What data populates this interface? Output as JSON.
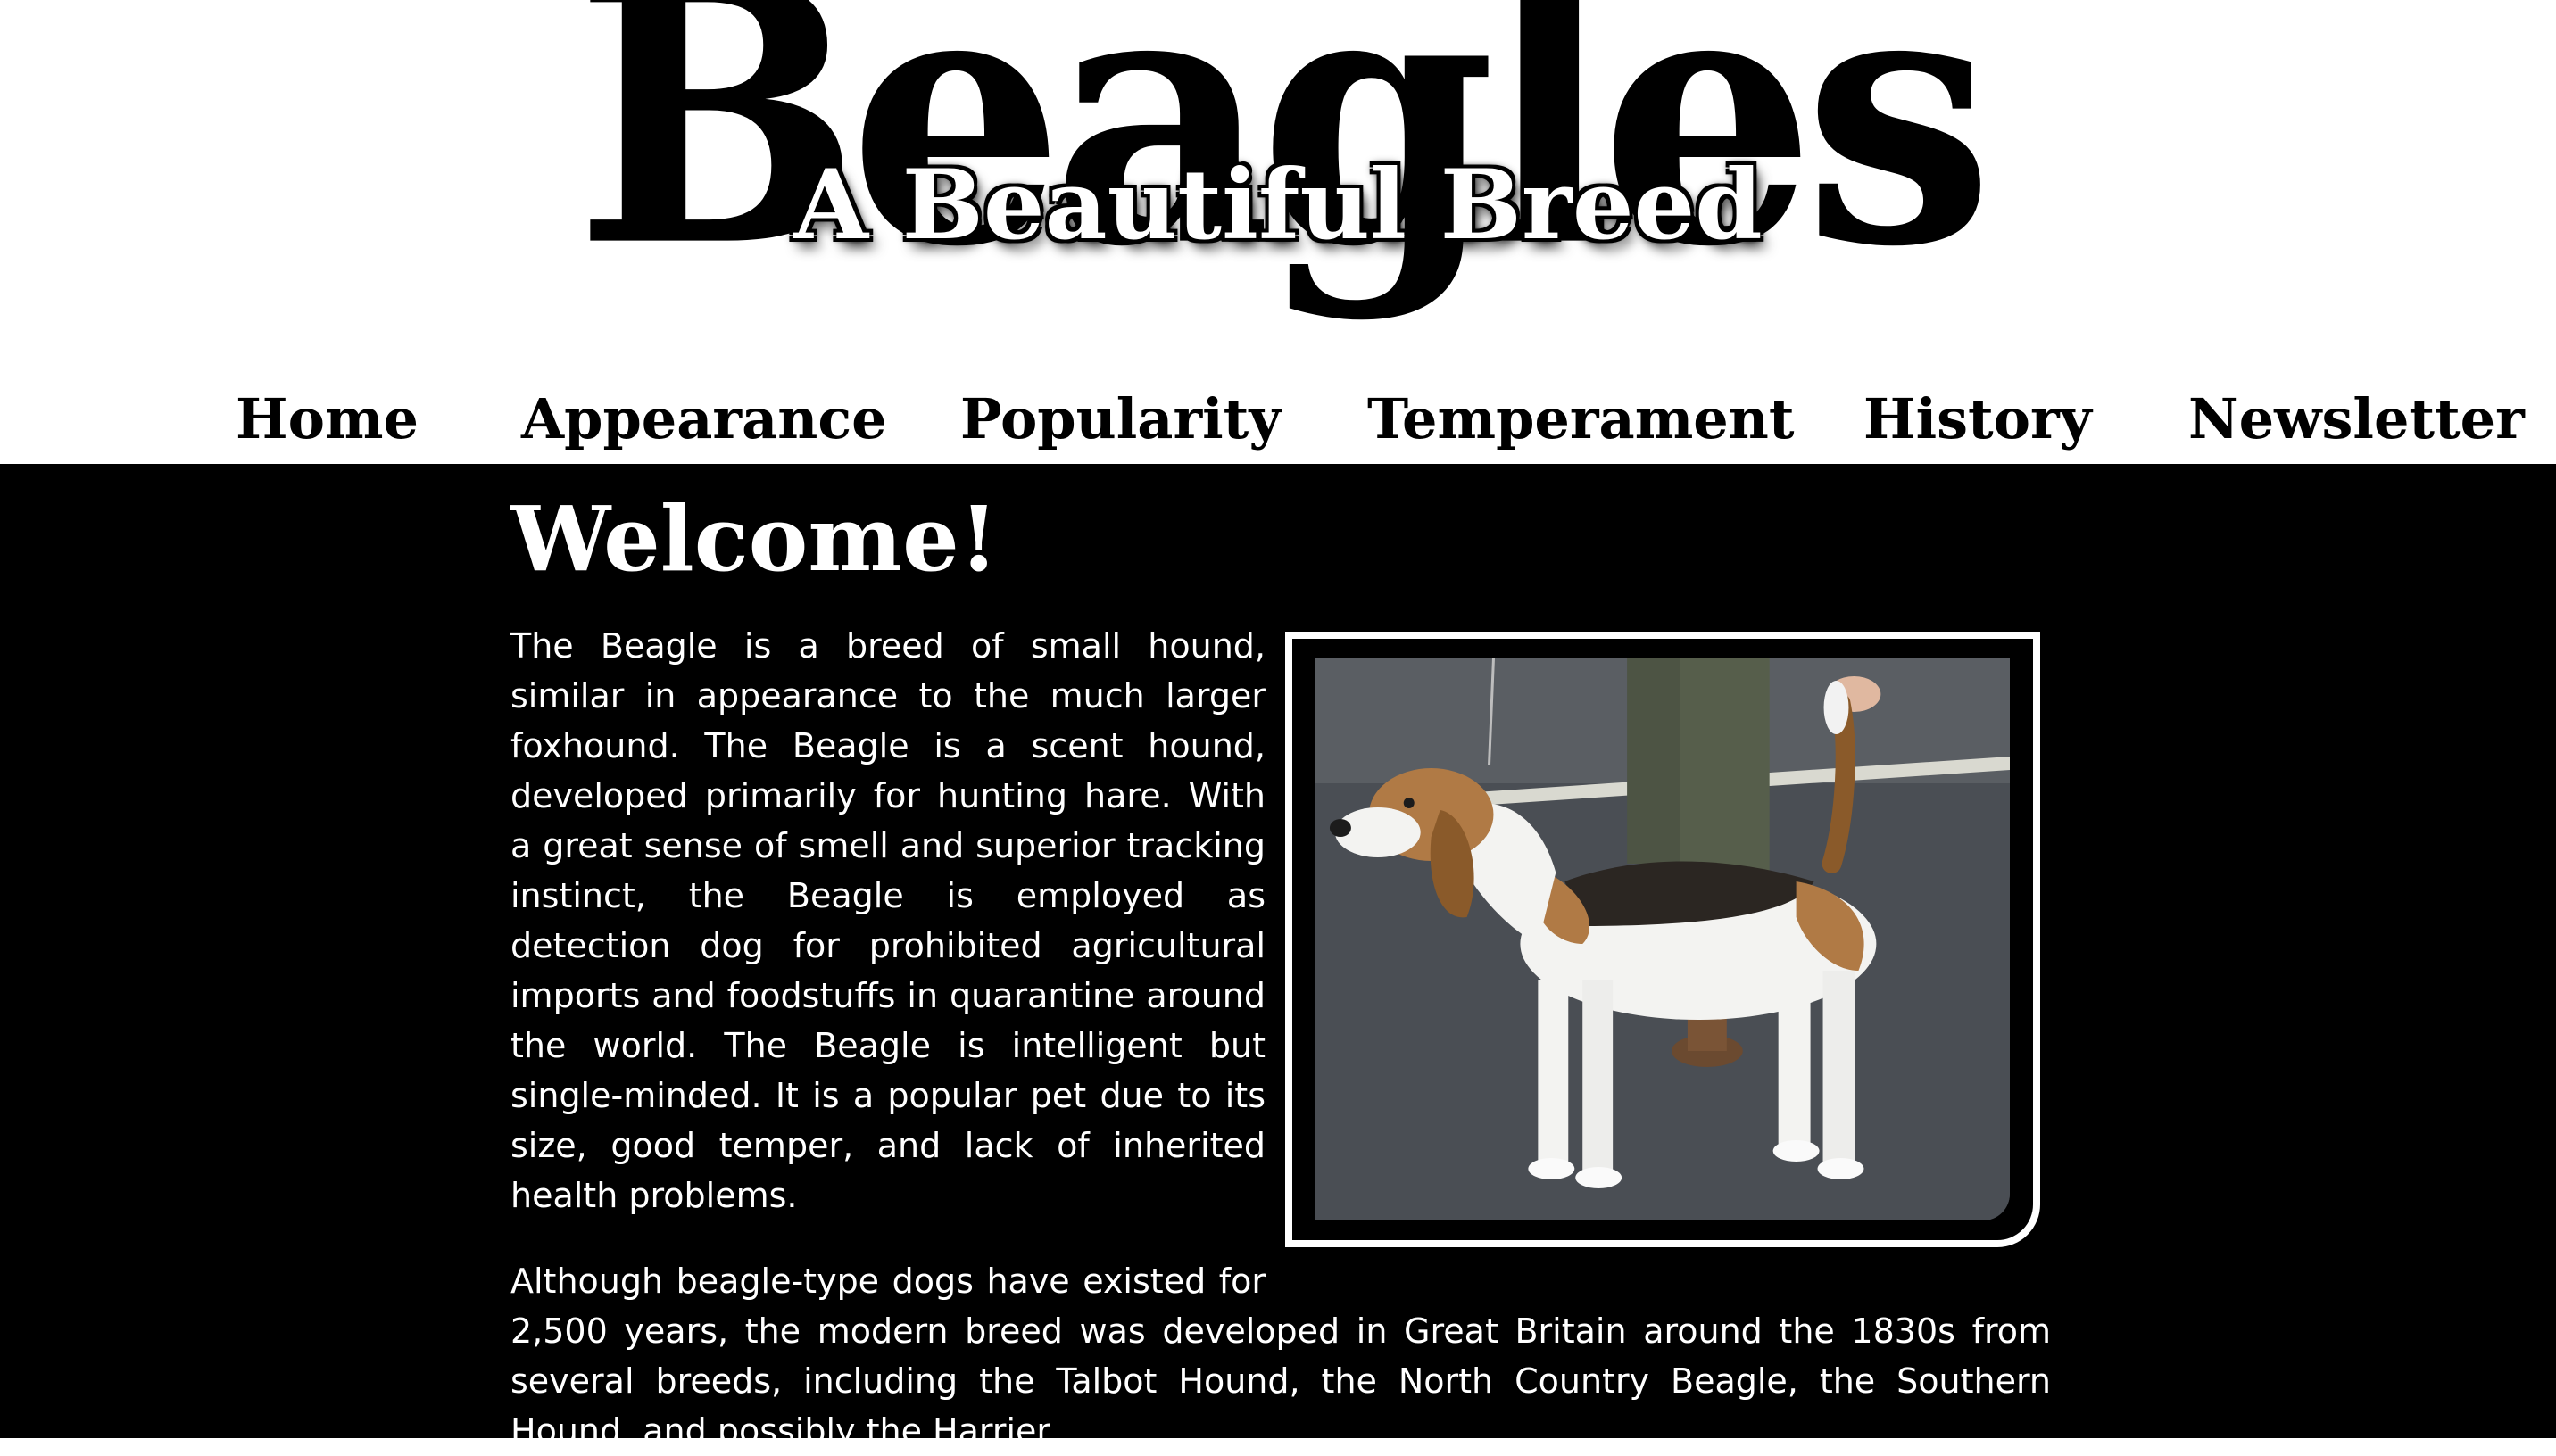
{
  "header": {
    "title": "Beagles",
    "subtitle": "A Beautiful Breed"
  },
  "nav": {
    "items": [
      {
        "label": "Home"
      },
      {
        "label": "Appearance"
      },
      {
        "label": "Popularity"
      },
      {
        "label": "Temperament"
      },
      {
        "label": "History"
      },
      {
        "label": "Newsletter"
      }
    ]
  },
  "main": {
    "heading": "Welcome!",
    "paragraphs": [
      "The Beagle is a breed of small hound, similar in appearance to the much larger foxhound. The Beagle is a scent hound, developed primarily for hunting hare. With a great sense of smell and superior tracking instinct, the Beagle is employed as detection dog for prohibited agricultural imports and foodstuffs in quarantine around the world. The Beagle is intelligent but single-minded. It is a popular pet due to its size, good temper, and lack of inherited health problems.",
      "Although beagle-type dogs have existed for 2,500 years, the modern breed was developed in Great Britain around the 1830s from several breeds, including the Talbot Hound, the North Country Beagle, the Southern Hound, and possibly the Harrier."
    ]
  },
  "colors": {
    "page_background": "#ffffff",
    "main_background": "#000000",
    "text": "#ffffff",
    "nav_text": "#000000"
  }
}
